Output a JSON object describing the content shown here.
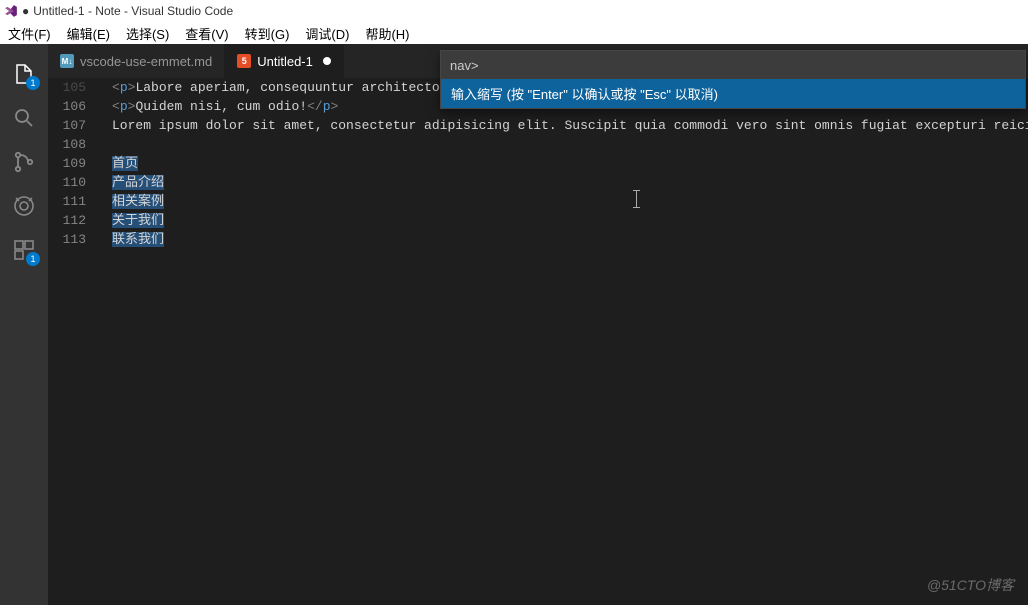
{
  "titlebar": {
    "dot": "●",
    "title": "Untitled-1 - Note - Visual Studio Code"
  },
  "menubar": {
    "items": [
      "文件(F)",
      "编辑(E)",
      "选择(S)",
      "查看(V)",
      "转到(G)",
      "调试(D)",
      "帮助(H)"
    ]
  },
  "activitybar": {
    "explorer_badge": "1",
    "extensions_badge": "1"
  },
  "tabs": {
    "tab0": {
      "icon": "M↓",
      "label": "vscode-use-emmet.md"
    },
    "tab1": {
      "icon": "5",
      "label": "Untitled-1"
    }
  },
  "quickinput": {
    "value": "nav>",
    "hint": "输入缩写 (按 \"Enter\" 以确认或按 \"Esc\" 以取消)"
  },
  "gutter": {
    "l105": "105",
    "l106": "106",
    "l107": "107",
    "l108": "108",
    "l109": "109",
    "l110": "110",
    "l111": "111",
    "l112": "112",
    "l113": "113"
  },
  "code": {
    "l105_a": "<",
    "l105_b": "p",
    "l105_c": ">",
    "l105_d": "Labore aperiam, consequuntur architecto",
    "l105_e": "",
    "l106_a": "<",
    "l106_b": "p",
    "l106_c": ">",
    "l106_d": "Quidem nisi, cum odio!",
    "l106_e": "</",
    "l106_f": "p",
    "l106_g": ">",
    "l107": "Lorem ipsum dolor sit amet, consectetur adipisicing elit. Suscipit quia commodi vero sint omnis fugiat excepturi reicie",
    "l109": "首页",
    "l110": "产品介绍",
    "l111": "相关案例",
    "l112": "关于我们",
    "l113": "联系我们"
  },
  "watermark": "@51CTO博客"
}
